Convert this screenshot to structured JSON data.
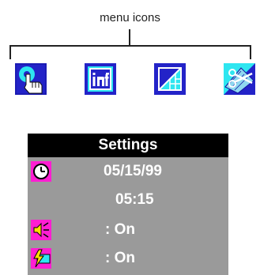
{
  "callout": {
    "label": "menu icons"
  },
  "menu_icons": [
    {
      "name": "hand-touch-icon"
    },
    {
      "name": "info-icon"
    },
    {
      "name": "display-grid-icon"
    },
    {
      "name": "scissors-icon"
    }
  ],
  "settings": {
    "title": "Settings",
    "date": "05/15/99",
    "time": "05:15",
    "sound": ": On",
    "power": ": On"
  },
  "colors": {
    "icon_blue": "#2323c8",
    "icon_cyan": "#2ee6f0",
    "badge_magenta": "#ff1ed2",
    "panel_gray": "#9a9a9a",
    "header_black": "#000000",
    "text_white": "#ffffff"
  }
}
